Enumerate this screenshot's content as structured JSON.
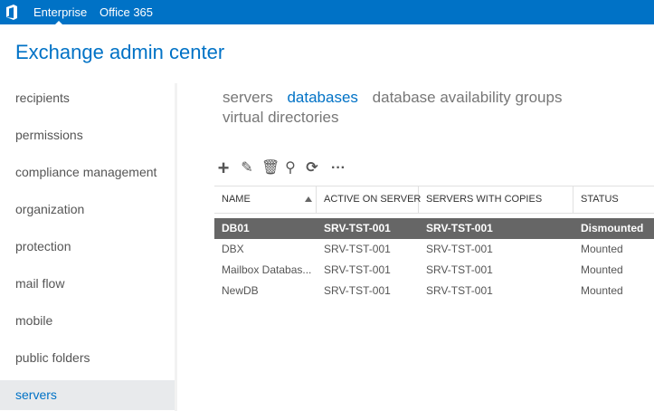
{
  "topbar": {
    "tabs": [
      "Enterprise",
      "Office 365"
    ],
    "brand_color": "#0072c6",
    "logo_icon": "office-logo-icon"
  },
  "header": {
    "title": "Exchange admin center"
  },
  "sidebar": {
    "items": [
      {
        "label": "recipients"
      },
      {
        "label": "permissions"
      },
      {
        "label": "compliance management"
      },
      {
        "label": "organization"
      },
      {
        "label": "protection"
      },
      {
        "label": "mail flow"
      },
      {
        "label": "mobile"
      },
      {
        "label": "public folders"
      },
      {
        "label": "servers",
        "selected": true
      }
    ]
  },
  "main": {
    "tabs": [
      {
        "label": "servers"
      },
      {
        "label": "databases",
        "active": true
      },
      {
        "label": "database availability groups"
      },
      {
        "label": "virtual directories"
      }
    ]
  },
  "toolbar": {
    "icons": [
      "add-icon",
      "edit-icon",
      "delete-icon",
      "search-icon",
      "refresh-icon",
      "more-icon"
    ]
  },
  "table": {
    "columns": [
      "NAME",
      "ACTIVE ON SERVER",
      "SERVERS WITH COPIES",
      "STATUS"
    ],
    "sort": "NAME ascending",
    "rows": [
      [
        "DB01",
        "SRV-TST-001",
        "SRV-TST-001",
        "Dismounted"
      ],
      [
        "DBX",
        "SRV-TST-001",
        "SRV-TST-001",
        "Mounted"
      ],
      [
        "Mailbox Databas...",
        "SRV-TST-001",
        "SRV-TST-001",
        "Mounted"
      ],
      [
        "NewDB",
        "SRV-TST-001",
        "SRV-TST-001",
        "Mounted"
      ]
    ],
    "selected_row": 0
  }
}
